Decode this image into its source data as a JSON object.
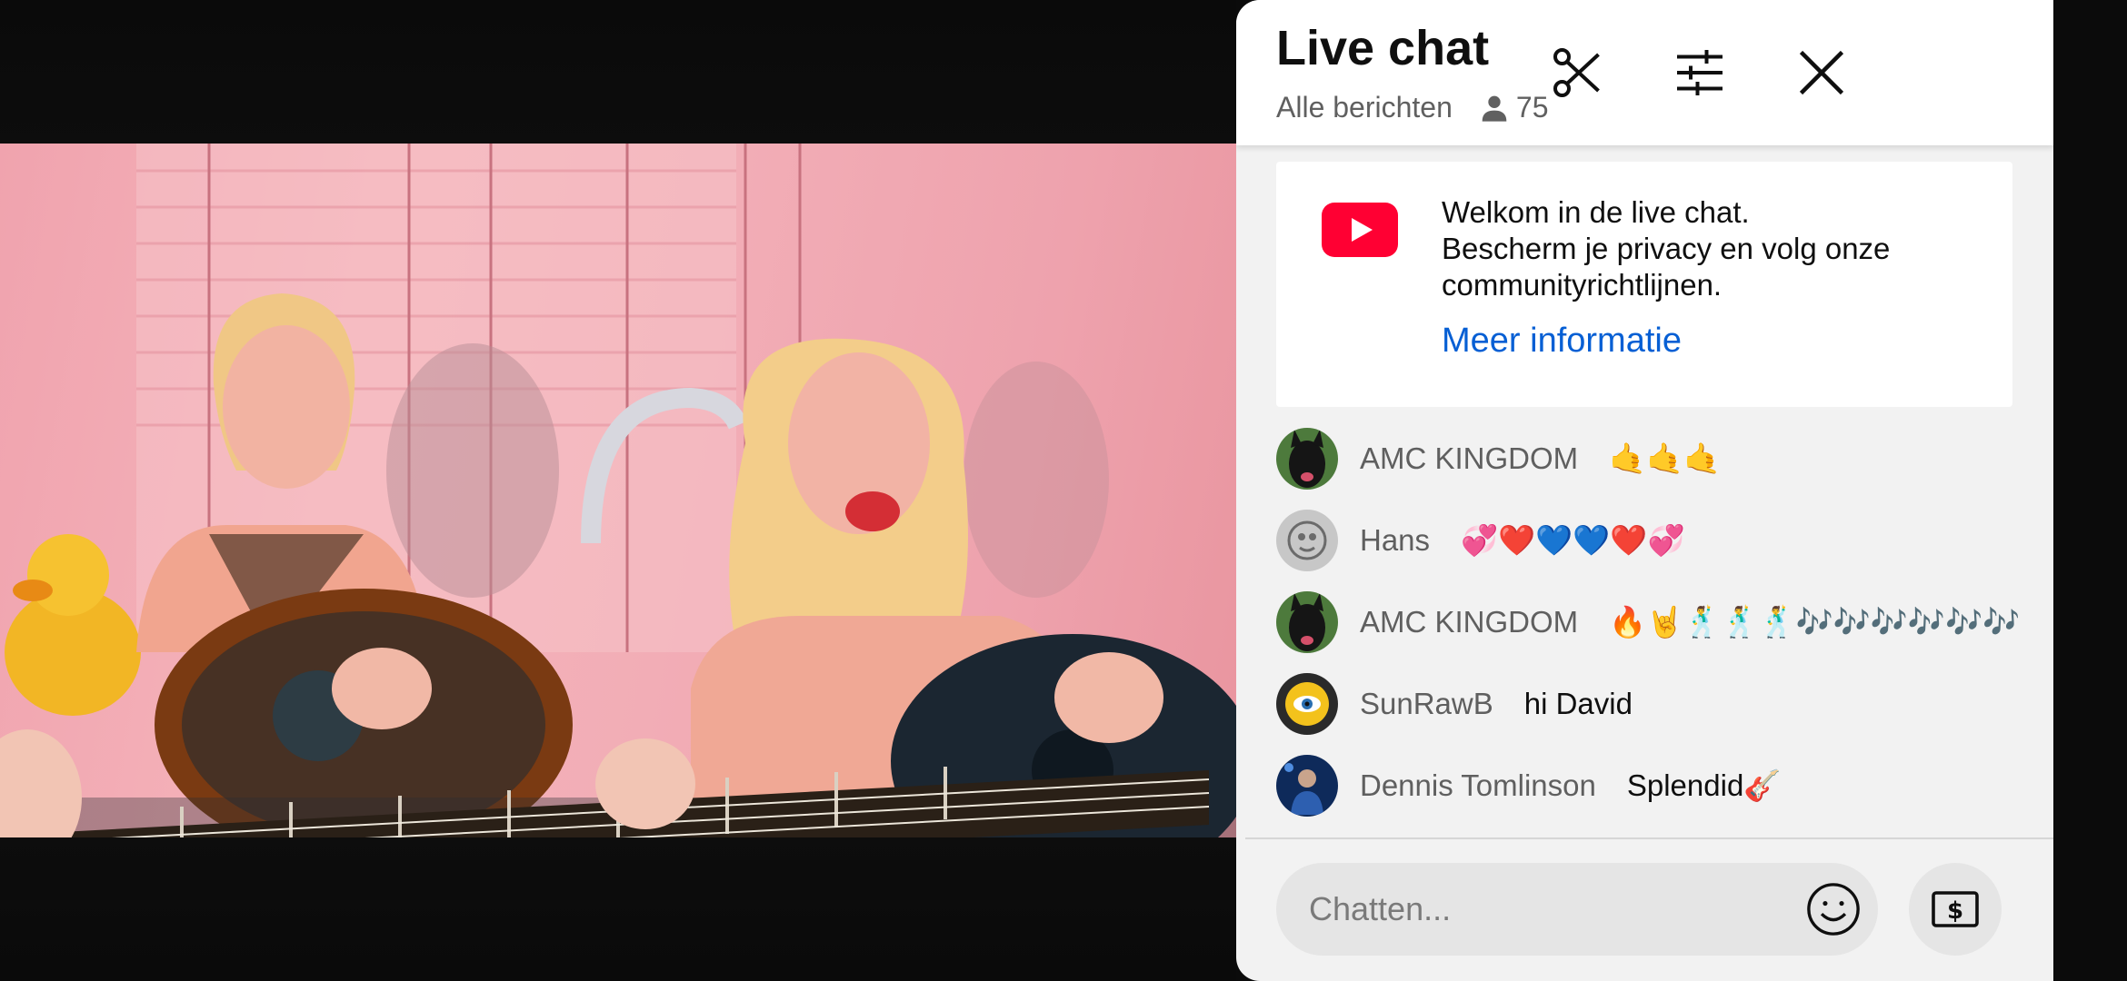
{
  "chat": {
    "title": "Live chat",
    "filter_label": "Alle berichten",
    "viewer_count": "75",
    "welcome": {
      "text_line1": "Welkom in de live chat.",
      "text_line2": "Bescherm je privacy en volg onze communityrichtlijnen.",
      "link": "Meer informatie"
    },
    "messages": [
      {
        "author": "AMC KINGDOM",
        "text": "🤙🤙🤙",
        "avatar": "black-dog-avatar"
      },
      {
        "author": "Hans",
        "text": "💞❤️💙💙❤️💞",
        "avatar": "grey-sketch-avatar"
      },
      {
        "author": "AMC KINGDOM",
        "text": "🔥🤘🕺🕺🕺🎶🎶🎶🎶🎶🎶",
        "avatar": "black-dog-avatar"
      },
      {
        "author": "SunRawB",
        "text": "hi David",
        "avatar": "sun-eye-avatar"
      },
      {
        "author": "Dennis Tomlinson",
        "text": "Splendid🎸",
        "avatar": "blue-photo-avatar"
      }
    ],
    "input_placeholder": "Chatten..."
  },
  "icons": {
    "clip": "scissors-icon",
    "settings": "sliders-icon",
    "close": "close-icon",
    "viewers": "person-icon",
    "logo": "youtube-logo-icon",
    "emoji": "emoji-icon",
    "super_chat": "dollar-bill-icon"
  },
  "colors": {
    "link": "#065fd4",
    "youtube_red": "#ff0033",
    "panel_bg": "#f2f2f2"
  }
}
